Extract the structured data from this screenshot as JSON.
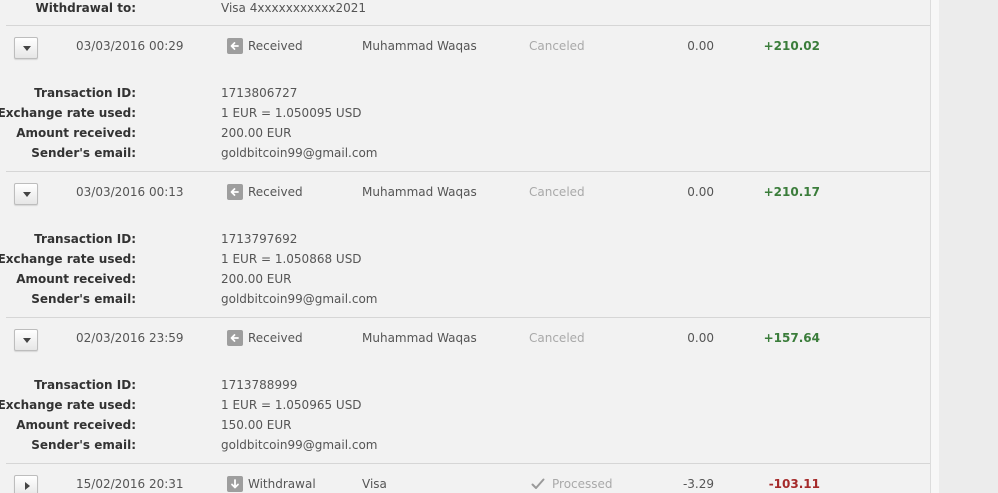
{
  "top": {
    "label": "Withdrawal to:",
    "value": "Visa 4xxxxxxxxxxx2021"
  },
  "detail_labels": {
    "transaction_id": "Transaction ID:",
    "exchange_rate": "Exchange rate used:",
    "amount_received": "Amount received:",
    "sender_email": "Sender's email:"
  },
  "transactions": [
    {
      "date": "03/03/2016 00:29",
      "type": "Received",
      "type_icon": "arrow-left-icon",
      "name": "Muhammad Waqas",
      "status": "Canceled",
      "fee": "0.00",
      "amount": "+210.02",
      "expanded": true,
      "details": {
        "transaction_id": "1713806727",
        "exchange_rate": "1 EUR = 1.050095 USD",
        "amount_received": "200.00 EUR",
        "sender_email": "goldbitcoin99@gmail.com"
      }
    },
    {
      "date": "03/03/2016 00:13",
      "type": "Received",
      "type_icon": "arrow-left-icon",
      "name": "Muhammad Waqas",
      "status": "Canceled",
      "fee": "0.00",
      "amount": "+210.17",
      "expanded": true,
      "details": {
        "transaction_id": "1713797692",
        "exchange_rate": "1 EUR = 1.050868 USD",
        "amount_received": "200.00 EUR",
        "sender_email": "goldbitcoin99@gmail.com"
      }
    },
    {
      "date": "02/03/2016 23:59",
      "type": "Received",
      "type_icon": "arrow-left-icon",
      "name": "Muhammad Waqas",
      "status": "Canceled",
      "fee": "0.00",
      "amount": "+157.64",
      "expanded": true,
      "details": {
        "transaction_id": "1713788999",
        "exchange_rate": "1 EUR = 1.050965 USD",
        "amount_received": "150.00 EUR",
        "sender_email": "goldbitcoin99@gmail.com"
      }
    },
    {
      "date": "15/02/2016 20:31",
      "type": "Withdrawal",
      "type_icon": "arrow-down-icon",
      "name": "Visa",
      "status": "Processed",
      "status_icon": "check-icon",
      "fee": "-3.29",
      "amount": "-103.11",
      "expanded": false
    }
  ],
  "colors": {
    "positive": "#3b7d3b",
    "negative": "#a52a2a",
    "muted_status": "#a9a9a9",
    "panel_bg": "#f2f2f2"
  }
}
